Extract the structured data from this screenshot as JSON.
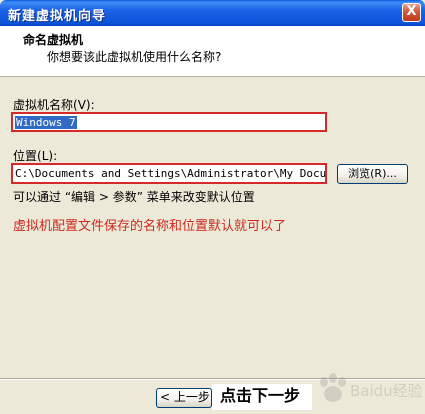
{
  "window": {
    "title": "新建虚拟机向导",
    "close_label": "X"
  },
  "header": {
    "title": "命名虚拟机",
    "subtitle": "你想要该此虚拟机使用什么名称?"
  },
  "form": {
    "name_label": "虚拟机名称",
    "name_accesskey": "(V):",
    "name_value": "Windows 7",
    "location_label": "位置",
    "location_accesskey": "(L):",
    "location_value": "C:\\Documents and Settings\\Administrator\\My Documents",
    "browse_label": "浏览(R)...",
    "hint": "可以通过 “编辑 > 参数” 菜单来改变默认位置"
  },
  "annotations": {
    "config_note": "虚拟机配置文件保存的名称和位置默认就可以了",
    "next_step": "点击下一步",
    "watermark": "Baidu经验"
  },
  "footer": {
    "back_label": "< 上一步"
  },
  "colors": {
    "title_bar": "#0c55db",
    "highlight_border": "#d42a2a",
    "annotation_text": "#cc2a1e",
    "selection": "#316ac5"
  }
}
